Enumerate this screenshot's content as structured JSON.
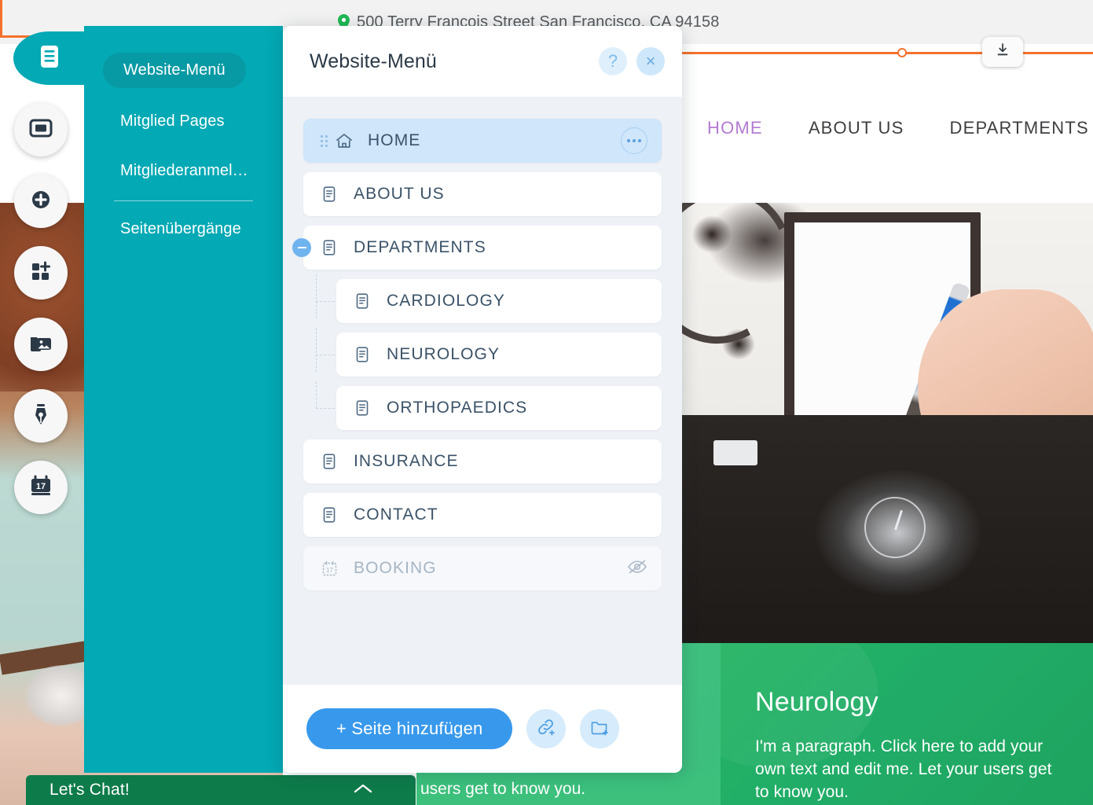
{
  "site": {
    "address": "500 Terry Francois Street San Francisco, CA 94158",
    "address_pin_icon": "location-pin-icon",
    "download_icon": "download-icon",
    "nav": [
      {
        "label": "HOME",
        "active": true
      },
      {
        "label": "ABOUT US",
        "active": false
      },
      {
        "label": "DEPARTMENTS",
        "active": false
      }
    ],
    "green_card": {
      "heading": "Neurology",
      "paragraph": "I'm a paragraph. Click here to add your own text and edit me. Let your users get to know you."
    },
    "mid_card_text": "users get to know you.",
    "chat": {
      "label": "Let's Chat!",
      "chevron_icon": "chevron-up-icon"
    }
  },
  "rail": {
    "items": [
      {
        "name": "pages-icon",
        "active": true
      },
      {
        "name": "section-icon",
        "active": false
      },
      {
        "name": "add-icon",
        "active": false
      },
      {
        "name": "apps-add-icon",
        "active": false
      },
      {
        "name": "media-icon",
        "active": false
      },
      {
        "name": "design-pen-icon",
        "active": false
      },
      {
        "name": "bookings-calendar-icon",
        "active": false
      }
    ]
  },
  "sidebar": {
    "items": [
      {
        "label": "Website-Menü",
        "selected": true
      },
      {
        "label": "Mitglied Pages",
        "selected": false
      },
      {
        "label": "Mitgliederanmel…",
        "selected": false
      },
      {
        "label": "Seitenübergänge",
        "selected": false
      }
    ]
  },
  "dialog": {
    "title": "Website-Menü",
    "help_icon": "help-question-icon",
    "help_label": "?",
    "close_icon": "close-icon",
    "close_label": "×",
    "pages": [
      {
        "label": "HOME",
        "icon": "home-icon",
        "level": 0,
        "active": true,
        "disabled": false,
        "has_dots_menu": true,
        "drag_handle": true,
        "collapse": false,
        "hidden_eye": false
      },
      {
        "label": "ABOUT US",
        "icon": "page-icon",
        "level": 0,
        "active": false,
        "disabled": false,
        "has_dots_menu": false,
        "drag_handle": false,
        "collapse": false,
        "hidden_eye": false
      },
      {
        "label": "DEPARTMENTS",
        "icon": "page-icon",
        "level": 0,
        "active": false,
        "disabled": false,
        "has_dots_menu": false,
        "drag_handle": false,
        "collapse": true,
        "hidden_eye": false
      },
      {
        "label": "CARDIOLOGY",
        "icon": "page-icon",
        "level": 1,
        "active": false,
        "disabled": false,
        "has_dots_menu": false,
        "drag_handle": false,
        "collapse": false,
        "hidden_eye": false
      },
      {
        "label": "NEUROLOGY",
        "icon": "page-icon",
        "level": 1,
        "active": false,
        "disabled": false,
        "has_dots_menu": false,
        "drag_handle": false,
        "collapse": false,
        "hidden_eye": false
      },
      {
        "label": "ORTHOPAEDICS",
        "icon": "page-icon",
        "level": 1,
        "active": false,
        "disabled": false,
        "has_dots_menu": false,
        "drag_handle": false,
        "collapse": false,
        "hidden_eye": false
      },
      {
        "label": "INSURANCE",
        "icon": "page-icon",
        "level": 0,
        "active": false,
        "disabled": false,
        "has_dots_menu": false,
        "drag_handle": false,
        "collapse": false,
        "hidden_eye": false
      },
      {
        "label": "CONTACT",
        "icon": "page-icon",
        "level": 0,
        "active": false,
        "disabled": false,
        "has_dots_menu": false,
        "drag_handle": false,
        "collapse": false,
        "hidden_eye": false
      },
      {
        "label": "BOOKING",
        "icon": "calendar-17-icon",
        "level": 0,
        "active": false,
        "disabled": true,
        "has_dots_menu": false,
        "drag_handle": false,
        "collapse": false,
        "hidden_eye": true
      }
    ],
    "footer": {
      "add_page_label": "+ Seite hinzufügen",
      "add_link_icon": "add-link-icon",
      "add_folder_icon": "add-folder-icon"
    }
  },
  "colors": {
    "teal": "#03a9b4",
    "teal_selected": "#089aa4",
    "accent_blue": "#3899ec",
    "light_blue": "#cfe6fb",
    "dialog_bg": "#eef1f6",
    "orange": "#f4712c",
    "green_card": "#20ac67",
    "chat_green": "#0e7b4a",
    "nav_active": "#b37ad1",
    "text_dark": "#3b5268"
  }
}
